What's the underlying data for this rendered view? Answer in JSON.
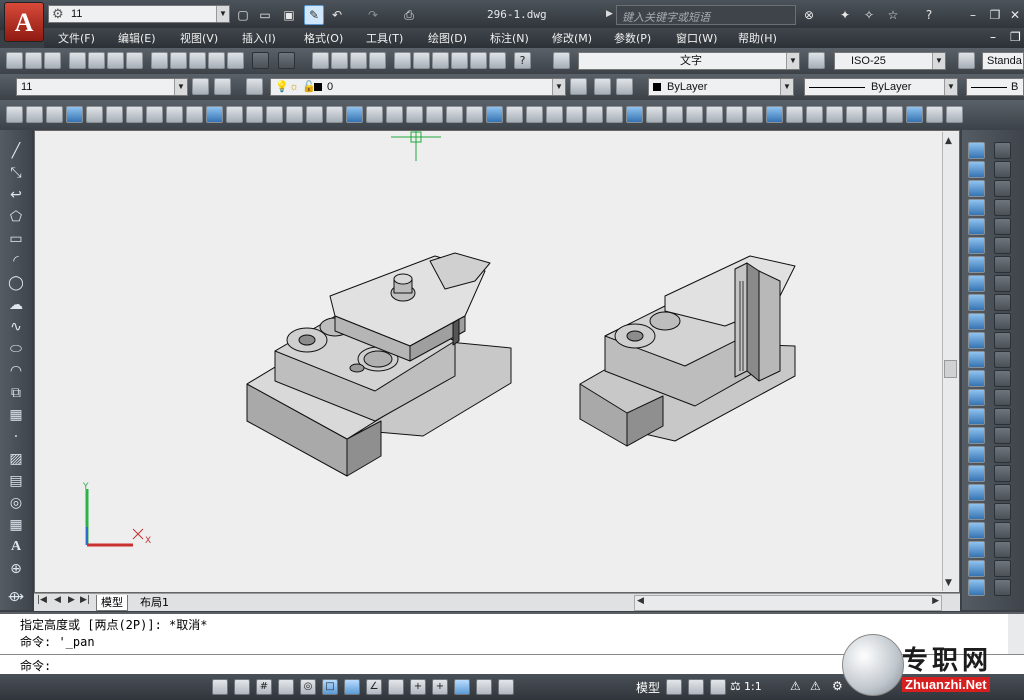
{
  "title": {
    "workspace": "11",
    "file_name": "296-1.dwg",
    "search_placeholder": "键入关键字或短语",
    "logo_letter": "A"
  },
  "menu": [
    "文件(F)",
    "编辑(E)",
    "视图(V)",
    "插入(I)",
    "格式(O)",
    "工具(T)",
    "绘图(D)",
    "标注(N)",
    "修改(M)",
    "参数(P)",
    "窗口(W)",
    "帮助(H)"
  ],
  "styles": {
    "text_style": "文字",
    "dim_style": "ISO-25",
    "table_style": "Standa"
  },
  "layers": {
    "workspace_combo": "11",
    "current_layer": "0",
    "color": "ByLayer",
    "linetype": "ByLayer",
    "lineweight": "B"
  },
  "tabs": [
    "模型",
    "布局1"
  ],
  "command": {
    "history": [
      "指定高度或 [两点(2P)]: *取消*",
      "命令: '_pan"
    ],
    "prompt": "命令:"
  },
  "status": {
    "model_label": "模型",
    "scale": "1:1"
  },
  "ucs": {
    "x": "X",
    "y": "Y"
  },
  "watermark": {
    "cn": "专职网",
    "url": "Zhuanzhi.Net"
  }
}
